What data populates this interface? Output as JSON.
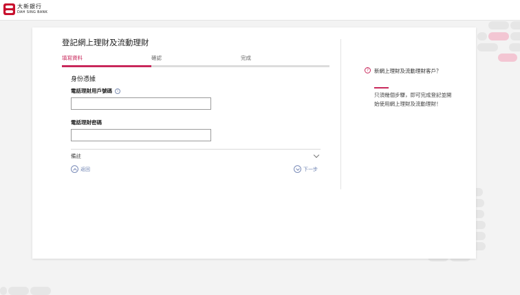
{
  "header": {
    "logo_cn": "大新銀行",
    "logo_en": "DAH SING BANK"
  },
  "form": {
    "title": "登記網上理財及流動理財",
    "steps": [
      {
        "label": "填寫資料",
        "active": true
      },
      {
        "label": "確認",
        "active": false
      },
      {
        "label": "完成",
        "active": false
      }
    ],
    "progress_fraction": 0.333,
    "section_title": "身份憑據",
    "phone_user_label": "電話理財用戶號碼",
    "phone_user_value": "",
    "phone_password_label": "電話理財密碼",
    "phone_password_value": "",
    "remarks_label": "備註",
    "back_label": "返回",
    "next_label": "下一步",
    "info_icon": "info-icon",
    "remarks_chevron": "chevron-down-icon"
  },
  "sidebar": {
    "title": "新網上理財及流動理財客戶？",
    "text": "只須幾個步驟，即可完成登記並開始使用網上理財及流動理財！",
    "icon": "question-icon"
  },
  "colors": {
    "accent": "#c8275a",
    "brand": "#c8102e",
    "link": "#6a7fb0",
    "background": "#f3f3f3"
  }
}
